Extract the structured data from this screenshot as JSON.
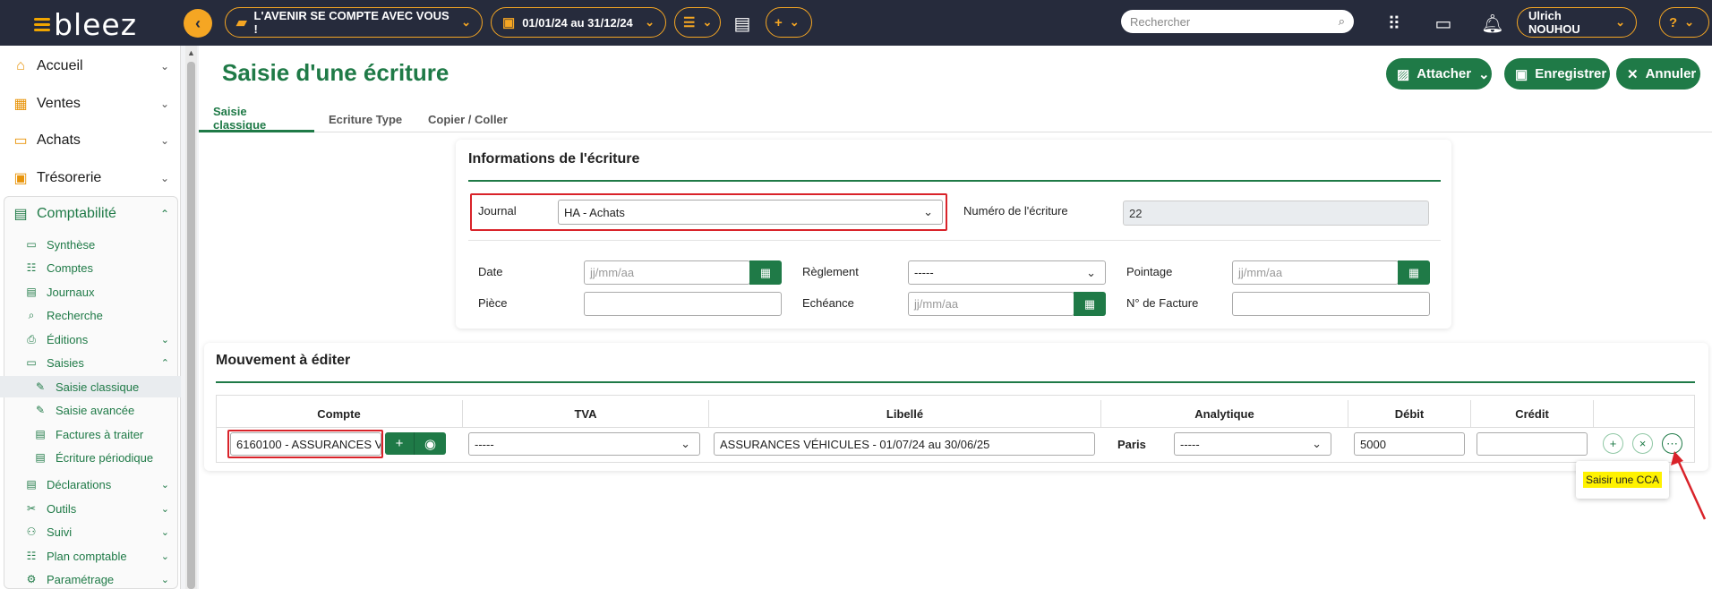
{
  "topbar": {
    "logo": "bleez",
    "company": "L'AVENIR SE COMPTE AVEC VOUS !",
    "period": "01/01/24 au 31/12/24",
    "search_placeholder": "Rechercher",
    "user": "Ulrich NOUHOU",
    "help": "?"
  },
  "sidebar": {
    "items": [
      {
        "label": "Accueil",
        "icon": "home-icon"
      },
      {
        "label": "Ventes",
        "icon": "store-icon"
      },
      {
        "label": "Achats",
        "icon": "inbox-icon"
      },
      {
        "label": "Trésorerie",
        "icon": "cash-icon"
      },
      {
        "label": "Comptabilité",
        "icon": "calculator-icon"
      }
    ],
    "compta_sub": [
      "Synthèse",
      "Comptes",
      "Journaux",
      "Recherche",
      "Éditions",
      "Saisies"
    ],
    "saisies_sub": [
      "Saisie classique",
      "Saisie avancée",
      "Factures à traiter",
      "Écriture périodique"
    ],
    "more": [
      "Déclarations",
      "Outils",
      "Suivi",
      "Plan comptable",
      "Paramétrage"
    ]
  },
  "page": {
    "title": "Saisie d'une écriture",
    "buttons": {
      "attach": "Attacher",
      "save": "Enregistrer",
      "cancel": "Annuler"
    },
    "tabs": [
      "Saisie classique",
      "Ecriture Type",
      "Copier / Coller"
    ]
  },
  "info": {
    "title": "Informations de l'écriture",
    "journal_label": "Journal",
    "journal_value": "HA - Achats",
    "numero_label": "Numéro de l'écriture",
    "numero_value": "22",
    "date_label": "Date",
    "date_placeholder": "jj/mm/aa",
    "reglement_label": "Règlement",
    "reglement_value": "-----",
    "pointage_label": "Pointage",
    "pointage_placeholder": "jj/mm/aa",
    "piece_label": "Pièce",
    "echeance_label": "Echéance",
    "echeance_placeholder": "jj/mm/aa",
    "facture_label": "N° de Facture"
  },
  "mouvement": {
    "title": "Mouvement à éditer",
    "columns": [
      "Compte",
      "TVA",
      "Libellé",
      "Analytique",
      "Débit",
      "Crédit"
    ],
    "row": {
      "compte": "6160100 - ASSURANCES V",
      "tva": "-----",
      "libelle": "ASSURANCES VÉHICULES - 01/07/24 au 30/06/25",
      "analytique_label": "Paris",
      "analytique": "-----",
      "debit": "5000",
      "credit": ""
    },
    "tooltip": "Saisir une CCA"
  },
  "colors": {
    "brand_green": "#1f7a47",
    "accent_orange": "#f5a623",
    "topbar": "#262b3c",
    "annotation_red": "#d9232a"
  }
}
